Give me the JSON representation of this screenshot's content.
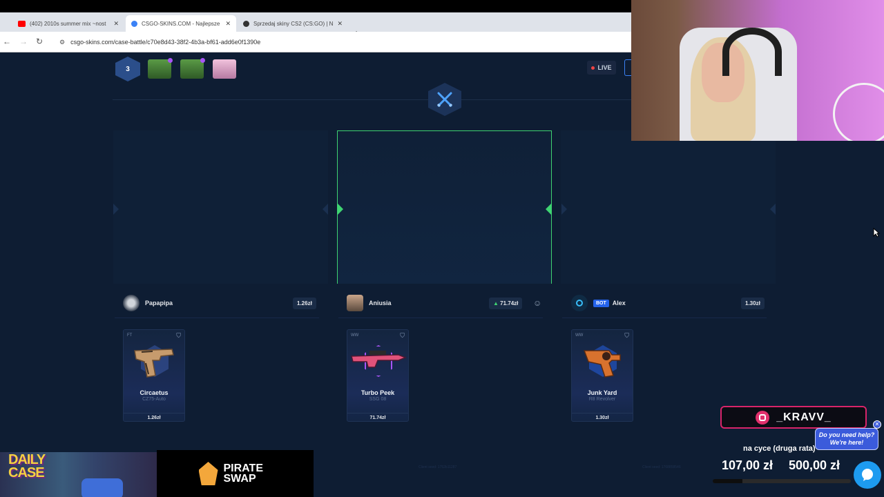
{
  "browser": {
    "tabs": [
      {
        "title": "(402) 2010s summer mix ~nost",
        "favicon_color": "#ff0000",
        "active": false
      },
      {
        "title": "CSGO-SKINS.COM - Najlepsze",
        "favicon_color": "#3b82f6",
        "active": true
      },
      {
        "title": "Sprzedaj skiny CS2 (CS:GO) | N",
        "favicon_color": "#333333",
        "active": false
      }
    ],
    "new_tab": "+",
    "url": "csgo-skins.com/case-battle/c70e8d43-38f2-4b3a-bf61-add6e0f1390e"
  },
  "battle": {
    "round_count": "3",
    "live_label": "LIVE",
    "cases": [
      {
        "icon": "green-case-icon",
        "color": "#4d8a3c"
      },
      {
        "icon": "green-case-icon",
        "color": "#4d8a3c"
      },
      {
        "icon": "pink-case-icon",
        "color": "#d9a3c2"
      }
    ],
    "players": [
      {
        "name": "Papapipa",
        "total": "1.26zł",
        "bot": false,
        "winner": false,
        "item": {
          "condition": "FT",
          "name": "Circaetus",
          "type": "CZ75-Auto",
          "price": "1.26zł",
          "color": "#6b7280"
        },
        "client_seed": "Client seed: 1752b11287"
      },
      {
        "name": "Aniusia",
        "total": "71.74zł",
        "bot": false,
        "winner": true,
        "item": {
          "condition": "WW",
          "name": "Turbo Peek",
          "type": "SSG 08",
          "price": "71.74zł",
          "color": "#a855f7"
        },
        "client_seed": ""
      },
      {
        "name": "Alex",
        "total": "1.30zł",
        "bot": true,
        "bot_label": "BOT",
        "winner": false,
        "item": {
          "condition": "WW",
          "name": "Junk Yard",
          "type": "R8 Revolver",
          "price": "1.30zł",
          "color": "#3b82f6"
        },
        "client_seed": "Client seed: 1768858546"
      }
    ]
  },
  "overlay": {
    "daily_case": "DAILY CASE",
    "pirate_swap": "PIRATE SWAP",
    "instagram": "_KRAVV_",
    "goal_label": "na cyce (druga rata)",
    "goal_current": "107,00 zł",
    "goal_target": "500,00 zł",
    "goal_progress": 0.214,
    "help_line1": "Do you need help?",
    "help_line2": "We're here!"
  }
}
